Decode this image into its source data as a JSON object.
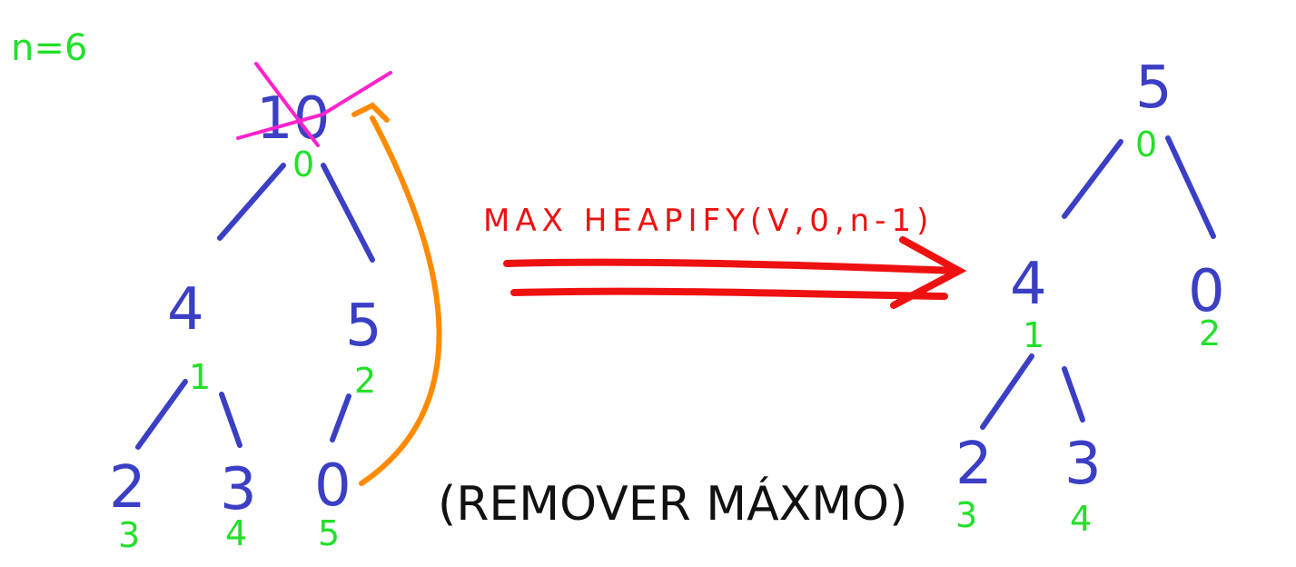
{
  "n_label": "n=6",
  "operation": "MAX HEAPIFY(V,0,n-1)",
  "caption": "(REMOVER MÁXMO)",
  "colors": {
    "value": "#3b3fc4",
    "index": "#22e02a",
    "operation": "#ee1111",
    "swap_arrow": "#ff8a00",
    "strike": "#ff22cc",
    "caption": "#111111"
  },
  "before_tree": {
    "nodes": [
      {
        "value": "10",
        "index": "0",
        "struck": true
      },
      {
        "value": "4",
        "index": "1"
      },
      {
        "value": "5",
        "index": "2"
      },
      {
        "value": "2",
        "index": "3"
      },
      {
        "value": "3",
        "index": "4"
      },
      {
        "value": "0",
        "index": "5"
      }
    ]
  },
  "after_tree": {
    "nodes": [
      {
        "value": "5",
        "index": "0"
      },
      {
        "value": "4",
        "index": "1"
      },
      {
        "value": "0",
        "index": "2"
      },
      {
        "value": "2",
        "index": "3"
      },
      {
        "value": "3",
        "index": "4"
      }
    ]
  }
}
